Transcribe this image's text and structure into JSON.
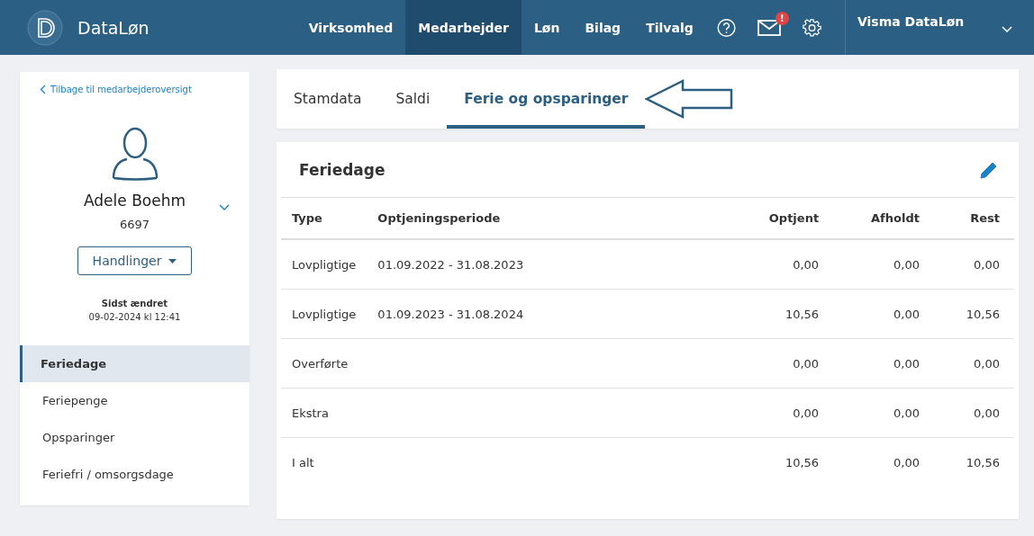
{
  "header": {
    "logo": "DataLøn",
    "nav": [
      {
        "label": "Virksomhed",
        "selected": false
      },
      {
        "label": "Medarbejder",
        "selected": true
      },
      {
        "label": "Løn",
        "selected": false
      },
      {
        "label": "Bilag",
        "selected": false
      },
      {
        "label": "Tilvalg",
        "selected": false
      }
    ],
    "mail_badge": "!",
    "company": "Visma DataLøn"
  },
  "sidebar": {
    "back_link": "Tilbage til medarbejderoversigt",
    "name": "Adele Boehm",
    "number": "6697",
    "actions_button": "Handlinger",
    "changed_label": "Sidst ændret",
    "changed_value": "09-02-2024 kl 12:41",
    "items": [
      {
        "label": "Feriedage",
        "selected": true
      },
      {
        "label": "Feriepenge",
        "selected": false
      },
      {
        "label": "Opsparinger",
        "selected": false
      },
      {
        "label": "Feriefri / omsorgsdage",
        "selected": false
      }
    ]
  },
  "tabs": [
    {
      "label": "Stamdata",
      "selected": false
    },
    {
      "label": "Saldi",
      "selected": false
    },
    {
      "label": "Ferie og opsparinger",
      "selected": true
    }
  ],
  "table": {
    "title": "Feriedage",
    "columns": [
      "Type",
      "Optjeningsperiode",
      "Optjent",
      "Afholdt",
      "Rest"
    ],
    "rows": [
      [
        "Lovpligtige",
        "01.09.2022 - 31.08.2023",
        "0,00",
        "0,00",
        "0,00"
      ],
      [
        "Lovpligtige",
        "01.09.2023 - 31.08.2024",
        "10,56",
        "0,00",
        "10,56"
      ],
      [
        "Overførte",
        "",
        "0,00",
        "0,00",
        "0,00"
      ],
      [
        "Ekstra",
        "",
        "0,00",
        "0,00",
        "0,00"
      ],
      [
        "I alt",
        "",
        "10,56",
        "0,00",
        "10,56"
      ]
    ]
  }
}
